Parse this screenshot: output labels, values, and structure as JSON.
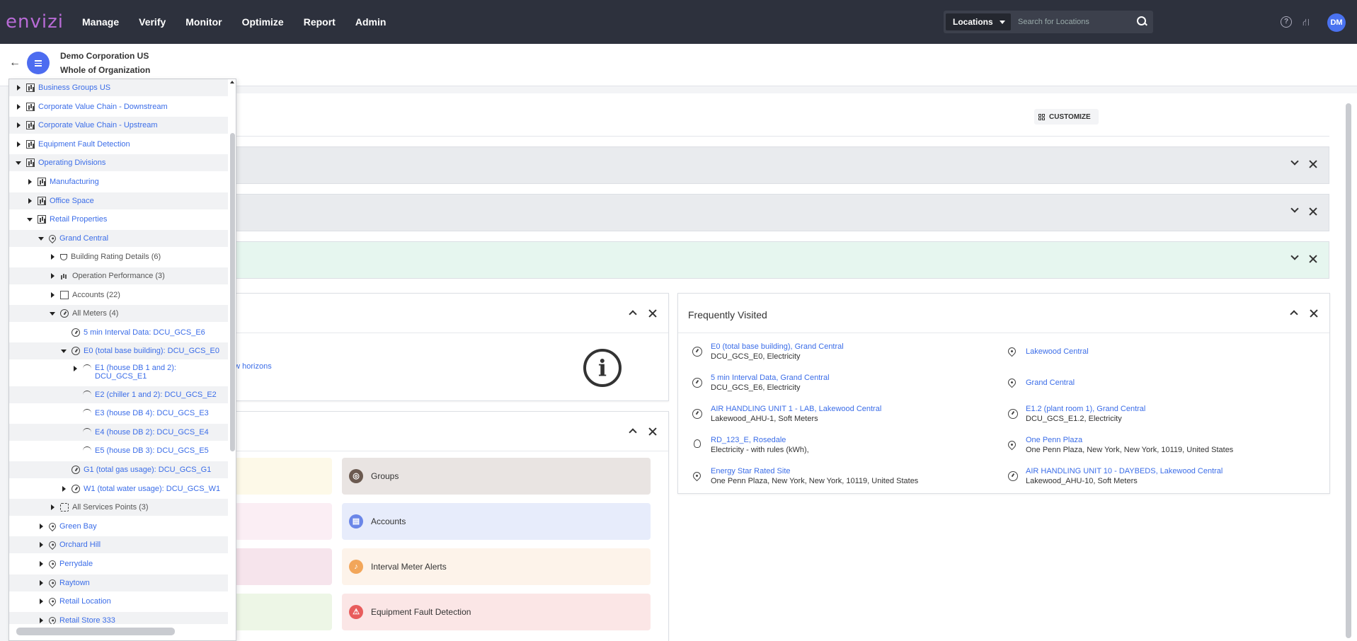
{
  "app": {
    "logo": "envizi",
    "nav": [
      "Manage",
      "Verify",
      "Monitor",
      "Optimize",
      "Report",
      "Admin"
    ],
    "search": {
      "scope": "Locations",
      "placeholder": "Search for Locations"
    },
    "user_initials": "DM"
  },
  "breadcrumb": {
    "org": "Demo Corporation US",
    "separator": "/",
    "current": "Whole of Organization"
  },
  "dashboard": {
    "customize_label": "CUSTOMIZE",
    "horizons_text": "ew horizons",
    "frequently_visited_title": "Frequently Visited",
    "tiles": [
      {
        "label": "Groups",
        "icon": "groups-icon",
        "bg": "#e9e4e2",
        "color": "#6b5a50"
      },
      {
        "label": "Accounts",
        "icon": "accounts-icon",
        "bg": "#e7ecfb",
        "color": "#6a86e8"
      },
      {
        "label": "Interval Meter Alerts",
        "icon": "bell-icon",
        "bg": "#fdf3ea",
        "color": "#f2a65a"
      },
      {
        "label": "Equipment Fault Detection",
        "icon": "fault-icon",
        "bg": "#fbe6e6",
        "color": "#e85c5c"
      }
    ],
    "frequently_visited": [
      {
        "title": "E0 (total base building), Grand Central",
        "sub": "DCU_GCS_E0, Electricity",
        "icon": "gauge"
      },
      {
        "title": "Lakewood Central",
        "sub": "",
        "icon": "pin"
      },
      {
        "title": "5 min Interval Data, Grand Central",
        "sub": "DCU_GCS_E6, Electricity",
        "icon": "gauge"
      },
      {
        "title": "Grand Central",
        "sub": "",
        "icon": "pin"
      },
      {
        "title": "AIR HANDLING UNIT 1 - LAB, Lakewood Central",
        "sub": "Lakewood_AHU-1, Soft Meters",
        "icon": "gauge"
      },
      {
        "title": "E1.2 (plant room 1), Grand Central",
        "sub": "DCU_GCS_E1.2, Electricity",
        "icon": "gauge"
      },
      {
        "title": "RD_123_E, Rosedale",
        "sub": "Electricity - with rules (kWh),",
        "icon": "bulb"
      },
      {
        "title": "One Penn Plaza",
        "sub": "One Penn Plaza, New York, New York, 10119, United States",
        "icon": "pin"
      },
      {
        "title": "Energy Star Rated Site",
        "sub": "One Penn Plaza, New York, New York, 10119, United States",
        "icon": "pin"
      },
      {
        "title": "AIR HANDLING UNIT 10 - DAYBEDS, Lakewood Central",
        "sub": "Lakewood_AHU-10, Soft Meters",
        "icon": "gauge"
      }
    ]
  },
  "tree": {
    "rows": [
      {
        "label": "Business Groups US",
        "toggle": "closed",
        "icon": "chart",
        "style": "link",
        "indent": 0
      },
      {
        "label": "Corporate Value Chain - Downstream",
        "toggle": "closed",
        "icon": "chart",
        "style": "link",
        "indent": 0
      },
      {
        "label": "Corporate Value Chain - Upstream",
        "toggle": "closed",
        "icon": "chart",
        "style": "link",
        "indent": 0
      },
      {
        "label": "Equipment Fault Detection",
        "toggle": "closed",
        "icon": "chart",
        "style": "link",
        "indent": 0
      },
      {
        "label": "Operating Divisions",
        "toggle": "open",
        "icon": "chart",
        "style": "link",
        "indent": 0
      },
      {
        "label": "Manufacturing",
        "toggle": "closed",
        "icon": "chart",
        "style": "link",
        "indent": 1
      },
      {
        "label": "Office Space",
        "toggle": "closed",
        "icon": "chart",
        "style": "link",
        "indent": 1
      },
      {
        "label": "Retail Properties",
        "toggle": "open",
        "icon": "chart",
        "style": "link",
        "indent": 1
      },
      {
        "label": "Grand Central",
        "toggle": "open",
        "icon": "pin",
        "style": "link",
        "indent": 2
      },
      {
        "label": "Building Rating Details (6)",
        "toggle": "closed",
        "icon": "trophy",
        "style": "grey",
        "indent": 3
      },
      {
        "label": "Operation Performance (3)",
        "toggle": "closed",
        "icon": "bars",
        "style": "grey",
        "indent": 3
      },
      {
        "label": "Accounts (22)",
        "toggle": "closed",
        "icon": "acct",
        "style": "grey",
        "indent": 3
      },
      {
        "label": "All Meters (4)",
        "toggle": "open",
        "icon": "gauge",
        "style": "grey",
        "indent": 3
      },
      {
        "label": "5 min Interval Data: DCU_GCS_E6",
        "toggle": "none",
        "icon": "gauge",
        "style": "link",
        "indent": 4
      },
      {
        "label": "E0 (total base building): DCU_GCS_E0",
        "toggle": "open",
        "icon": "gauge",
        "style": "link",
        "indent": 4
      },
      {
        "label": "E1 (house DB 1 and 2):",
        "label2": "DCU_GCS_E1",
        "toggle": "closed",
        "icon": "sub",
        "style": "link",
        "indent": 5
      },
      {
        "label": "E2 (chiller 1 and 2): DCU_GCS_E2",
        "toggle": "none",
        "icon": "sub",
        "style": "link",
        "indent": 5
      },
      {
        "label": "E3 (house DB 4): DCU_GCS_E3",
        "toggle": "none",
        "icon": "sub",
        "style": "link",
        "indent": 5
      },
      {
        "label": "E4 (house DB 2): DCU_GCS_E4",
        "toggle": "none",
        "icon": "sub",
        "style": "link",
        "indent": 5
      },
      {
        "label": "E5 (house DB 3): DCU_GCS_E5",
        "toggle": "none",
        "icon": "sub",
        "style": "link",
        "indent": 5
      },
      {
        "label": "G1 (total gas usage): DCU_GCS_G1",
        "toggle": "none",
        "icon": "gauge",
        "style": "link",
        "indent": 4
      },
      {
        "label": "W1 (total water usage): DCU_GCS_W1",
        "toggle": "closed",
        "icon": "gauge",
        "style": "link",
        "indent": 4
      },
      {
        "label": "All Services Points (3)",
        "toggle": "closed",
        "icon": "svc",
        "style": "grey",
        "indent": 3
      },
      {
        "label": "Green Bay",
        "toggle": "closed",
        "icon": "pin",
        "style": "link",
        "indent": 2
      },
      {
        "label": "Orchard Hill",
        "toggle": "closed",
        "icon": "pin",
        "style": "link",
        "indent": 2
      },
      {
        "label": "Perrydale",
        "toggle": "closed",
        "icon": "pin",
        "style": "link",
        "indent": 2
      },
      {
        "label": "Raytown",
        "toggle": "closed",
        "icon": "pin",
        "style": "link",
        "indent": 2
      },
      {
        "label": "Retail Location",
        "toggle": "closed",
        "icon": "pin",
        "style": "link",
        "indent": 2
      },
      {
        "label": "Retail Store 333",
        "toggle": "closed",
        "icon": "pin",
        "style": "link",
        "indent": 2
      }
    ]
  }
}
